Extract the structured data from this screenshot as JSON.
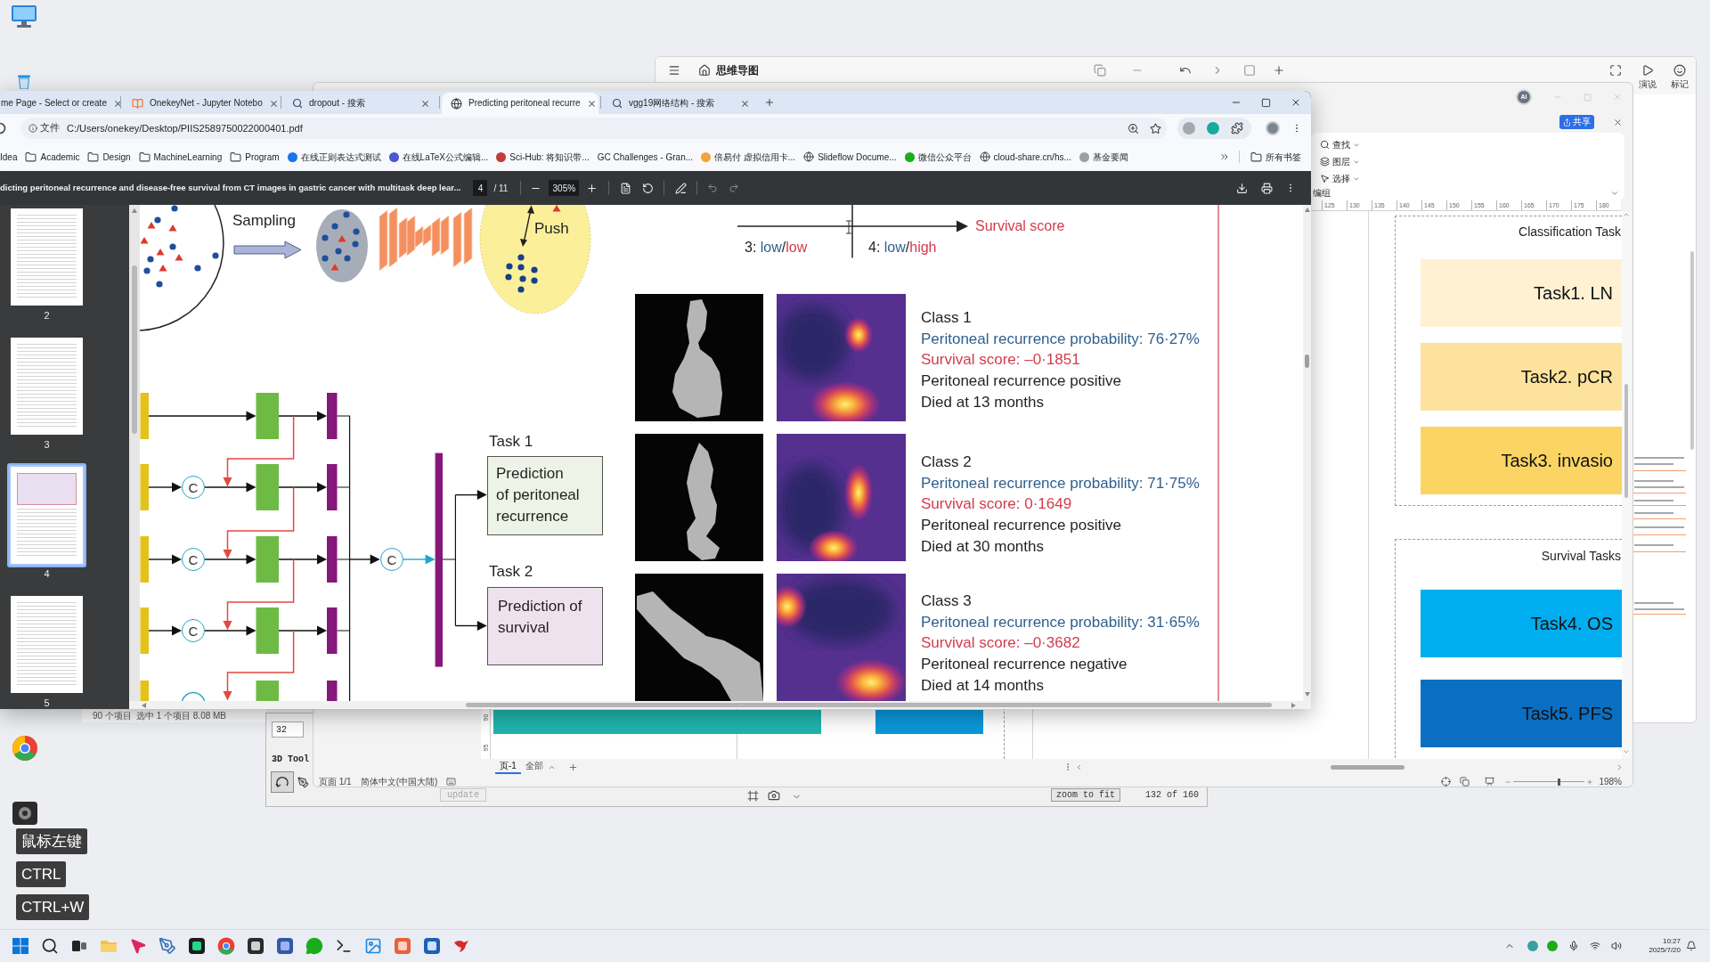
{
  "desktop": {
    "key_overlay": [
      "鼠标左键",
      "CTRL",
      "CTRL+W"
    ]
  },
  "file_explorer": {
    "item_count": "90 个项目",
    "selection": "选中 1 个项目 8.08 MB"
  },
  "tool_window": {
    "title": "3D Tool",
    "field_value": "32",
    "update_button": {
      "label": "update",
      "disabled": true
    },
    "zoom_button": "zoom to fit",
    "frame_counter": "132 of 160"
  },
  "mindmap_window": {
    "title": "思维导图",
    "actions": [
      "演说",
      "标记"
    ]
  },
  "diagram_window": {
    "ai_badge": "AI",
    "share_button": "共享",
    "ribbon": [
      {
        "label": "查找",
        "kind": "search"
      },
      {
        "label": "图层",
        "kind": "layers"
      },
      {
        "label": "选择",
        "kind": "select"
      }
    ],
    "ribbon_group": "编组",
    "ruler": [
      "125",
      "130",
      "135",
      "140",
      "145",
      "150",
      "155",
      "160",
      "165",
      "170",
      "175",
      "180"
    ],
    "side_ruler": [
      "90",
      "95"
    ],
    "groups": [
      {
        "title": "Classification Task",
        "tasks": [
          {
            "label": "Task1. LN",
            "color": "#fff1d2"
          },
          {
            "label": "Task2. pCR",
            "color": "#fce29c"
          },
          {
            "label": "Task3. invasio",
            "color": "#fbd464"
          }
        ]
      },
      {
        "title": "Survival Tasks",
        "tasks": [
          {
            "label": "Task4. OS",
            "color": "#00aeef"
          },
          {
            "label": "Task5. PFS",
            "color": "#0a6fc2"
          }
        ]
      }
    ],
    "page_tabs": [
      {
        "label": "页-1",
        "selected": true
      },
      {
        "label": "全部",
        "selected": false
      }
    ],
    "status": [
      "页面 1/1",
      "简体中文(中国大陆)"
    ],
    "zoom": {
      "label": "198%",
      "level": 0.62
    }
  },
  "browser": {
    "tabs": [
      {
        "title": "me Page - Select or create",
        "kind": "none",
        "selected": false
      },
      {
        "title": "OnekeyNet - Jupyter Notebo",
        "kind": "notebook",
        "selected": false
      },
      {
        "title": "dropout - 搜索",
        "kind": "search",
        "selected": false
      },
      {
        "title": "Predicting peritoneal recurre",
        "kind": "globe",
        "selected": true
      },
      {
        "title": "vgg19网络结构 - 搜索",
        "kind": "search",
        "selected": false
      }
    ],
    "address": {
      "chip": "文件",
      "url": "C:/Users/onekey/Desktop/PIIS2589750022000401.pdf"
    },
    "bookmarks": [
      {
        "label": "Idea",
        "kind": "plain"
      },
      {
        "label": "Academic",
        "kind": "folder"
      },
      {
        "label": "Design",
        "kind": "folder"
      },
      {
        "label": "MachineLearning",
        "kind": "folder"
      },
      {
        "label": "Program",
        "kind": "folder"
      },
      {
        "label": "在线正则表达式测试",
        "kind": "site",
        "color": "#1a73e8"
      },
      {
        "label": "在线LaTeX公式编辑...",
        "kind": "site",
        "color": "#4b56d2"
      },
      {
        "label": "Sci-Hub: 将知识带...",
        "kind": "site",
        "color": "#c23b3b"
      },
      {
        "label": "GC Challenges - Gran...",
        "kind": "plain"
      },
      {
        "label": "倍易付 虚拟信用卡...",
        "kind": "site",
        "color": "#f2a33a"
      },
      {
        "label": "Slideflow Docume...",
        "kind": "web"
      },
      {
        "label": "微信公众平台",
        "kind": "site",
        "color": "#1aad19"
      },
      {
        "label": "cloud-share.cn/hs...",
        "kind": "web"
      },
      {
        "label": "基金要闻",
        "kind": "site",
        "color": "#9aa0a6"
      }
    ],
    "all_bookmarks": "所有书签",
    "pdf": {
      "title": "dicting peritoneal recurrence and disease-free survival from CT images in gastric cancer with multitask deep lear...",
      "page": "4",
      "page_total": "/ 11",
      "zoom": "305%",
      "thumbnails": [
        {
          "label": "2",
          "selected": false
        },
        {
          "label": "3",
          "selected": false
        },
        {
          "label": "4",
          "selected": true
        },
        {
          "label": "5",
          "selected": false
        }
      ],
      "figure": {
        "sampling_label": "Sampling",
        "push_label": "Push",
        "axis_label": "Survival score",
        "quadrants": [
          {
            "index": "3:",
            "parts": [
              {
                "text": "low",
                "kind": "recurrence"
              },
              {
                "text": "/",
                "kind": "plain"
              },
              {
                "text": "low",
                "kind": "survival"
              }
            ]
          },
          {
            "index": "4:",
            "parts": [
              {
                "text": "low",
                "kind": "recurrence"
              },
              {
                "text": "/",
                "kind": "plain"
              },
              {
                "text": "high",
                "kind": "survival"
              }
            ]
          }
        ],
        "concat_nodes": [
          "C",
          "C",
          "C"
        ],
        "merge_node": "C",
        "tasks": [
          {
            "label": "Task 1",
            "text": "Prediction\nof peritoneal\nrecurrence",
            "color": "#edf4e7"
          },
          {
            "label": "Task 2",
            "text": "Prediction of\nsurvival",
            "color": "#eee2ee"
          }
        ],
        "cases": [
          {
            "title": "Class 1",
            "probability": "Peritoneal recurrence probability: 76·27%",
            "survival_score": "Survival score: –0·1851",
            "outcome": "Peritoneal recurrence positive",
            "death": "Died at 13 months"
          },
          {
            "title": "Class 2",
            "probability": "Peritoneal recurrence probability: 71·75%",
            "survival_score": "Survival score: 0·1649",
            "outcome": "Peritoneal recurrence positive",
            "death": "Died at 30 months"
          },
          {
            "title": "Class 3",
            "probability": "Peritoneal recurrence probability: 31·65%",
            "survival_score": "Survival score: –0·3682",
            "outcome": "Peritoneal recurrence negative",
            "death": "Died at 14 months"
          }
        ]
      }
    }
  },
  "taskbar": {
    "time": "10:27",
    "date": "2025/7/20"
  }
}
